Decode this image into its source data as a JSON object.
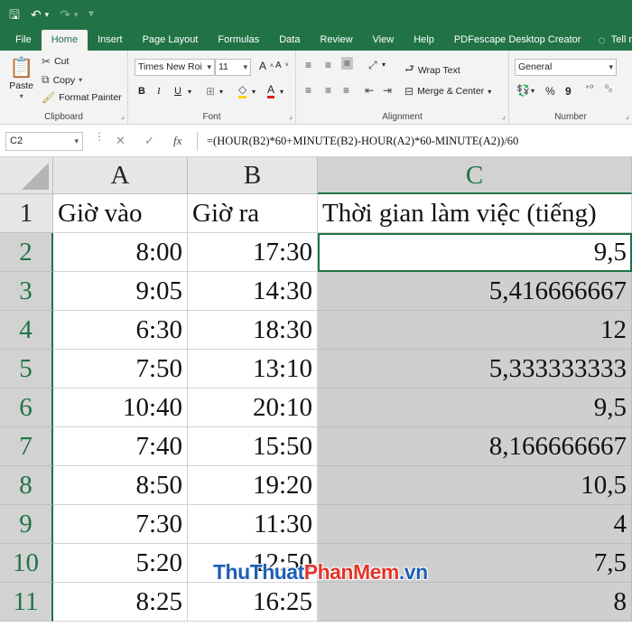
{
  "quick_access": {
    "save": "🖫",
    "undo": "↶",
    "undo_dd": "▾",
    "redo": "↷",
    "redo_dd": "▾",
    "customize": "▿"
  },
  "tabs": [
    "File",
    "Home",
    "Insert",
    "Page Layout",
    "Formulas",
    "Data",
    "Review",
    "View",
    "Help",
    "PDFescape Desktop Creator"
  ],
  "tell_me": "Tell m",
  "clipboard": {
    "paste": "Paste",
    "cut": "Cut",
    "copy": "Copy",
    "format_painter": "Format Painter",
    "label": "Clipboard"
  },
  "font": {
    "name": "Times New Roi",
    "size": "11",
    "bold": "B",
    "italic": "I",
    "underline": "U",
    "grow": "A",
    "shrink": "A",
    "label": "Font"
  },
  "alignment": {
    "wrap_text": "Wrap Text",
    "merge_center": "Merge & Center",
    "label": "Alignment"
  },
  "number": {
    "format": "General",
    "percent": "%",
    "comma": "9",
    "label": "Number"
  },
  "formula_bar": {
    "name_box": "C2",
    "cancel": "✕",
    "enter": "✓",
    "fx": "fx",
    "formula": "=(HOUR(B2)*60+MINUTE(B2)-HOUR(A2)*60-MINUTE(A2))/60"
  },
  "columns": [
    "A",
    "B",
    "C"
  ],
  "rows": [
    {
      "n": "1",
      "a": "Giờ vào",
      "b": "Giờ ra",
      "c": "Thời gian làm việc (tiếng)"
    },
    {
      "n": "2",
      "a": "8:00",
      "b": "17:30",
      "c": "9,5"
    },
    {
      "n": "3",
      "a": "9:05",
      "b": "14:30",
      "c": "5,416666667"
    },
    {
      "n": "4",
      "a": "6:30",
      "b": "18:30",
      "c": "12"
    },
    {
      "n": "5",
      "a": "7:50",
      "b": "13:10",
      "c": "5,333333333"
    },
    {
      "n": "6",
      "a": "10:40",
      "b": "20:10",
      "c": "9,5"
    },
    {
      "n": "7",
      "a": "7:40",
      "b": "15:50",
      "c": "8,166666667"
    },
    {
      "n": "8",
      "a": "8:50",
      "b": "19:20",
      "c": "10,5"
    },
    {
      "n": "9",
      "a": "7:30",
      "b": "11:30",
      "c": "4"
    },
    {
      "n": "10",
      "a": "5:20",
      "b": "12:50",
      "c": "7,5"
    },
    {
      "n": "11",
      "a": "8:25",
      "b": "16:25",
      "c": "8"
    }
  ],
  "watermark": {
    "part1": "ThuThuat",
    "part2": "PhanMem",
    "part3": ".vn"
  },
  "colors": {
    "excel_green": "#217346",
    "selection_fill": "#cfcfcf"
  }
}
